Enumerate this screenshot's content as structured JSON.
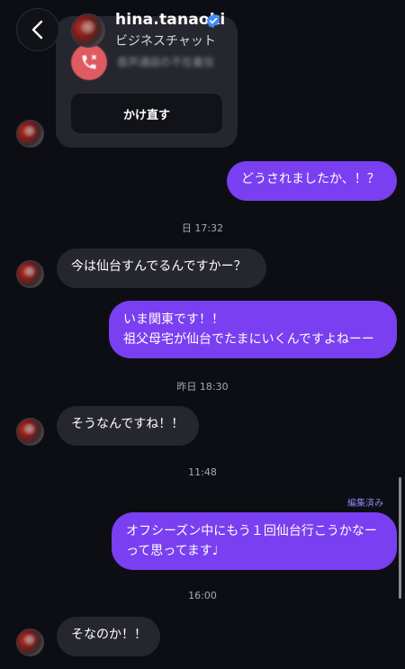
{
  "header": {
    "username": "hina.tanaoki",
    "subtitle": "ビジネスチャット"
  },
  "call_card": {
    "missed_label": "音声通話の不在着信",
    "callback_label": "かけ直す"
  },
  "messages": [
    {
      "type": "outgoing",
      "text": "どうされましたか、！？"
    },
    {
      "type": "time",
      "text": "日 17:32"
    },
    {
      "type": "incoming",
      "text": "今は仙台すんでるんですかー？"
    },
    {
      "type": "outgoing",
      "lines": [
        "いま関東です！！",
        "祖父母宅が仙台でたまにいくんですよねーー"
      ]
    },
    {
      "type": "time",
      "text": "昨日 18:30"
    },
    {
      "type": "incoming",
      "text": "そうなんですね！！"
    },
    {
      "type": "time",
      "text": "11:48"
    },
    {
      "type": "edited_label",
      "text": "編集済み"
    },
    {
      "type": "outgoing",
      "lines": [
        "オフシーズン中にもう１回仙台行こうかなー",
        "って思ってます♩"
      ]
    },
    {
      "type": "time",
      "text": "16:00"
    },
    {
      "type": "incoming",
      "text": "そなのか！！"
    }
  ],
  "colors": {
    "background": "#0d0e14",
    "incoming_bubble": "#26272e",
    "outgoing_bubble": "#7a3ff0",
    "missed_call": "#e05a62",
    "verified": "#3f8cf5",
    "edited_label": "#8e86f5"
  },
  "icons": {
    "back": "chevron-left-icon",
    "verified": "verified-badge-icon",
    "missed_call": "phone-icon"
  }
}
